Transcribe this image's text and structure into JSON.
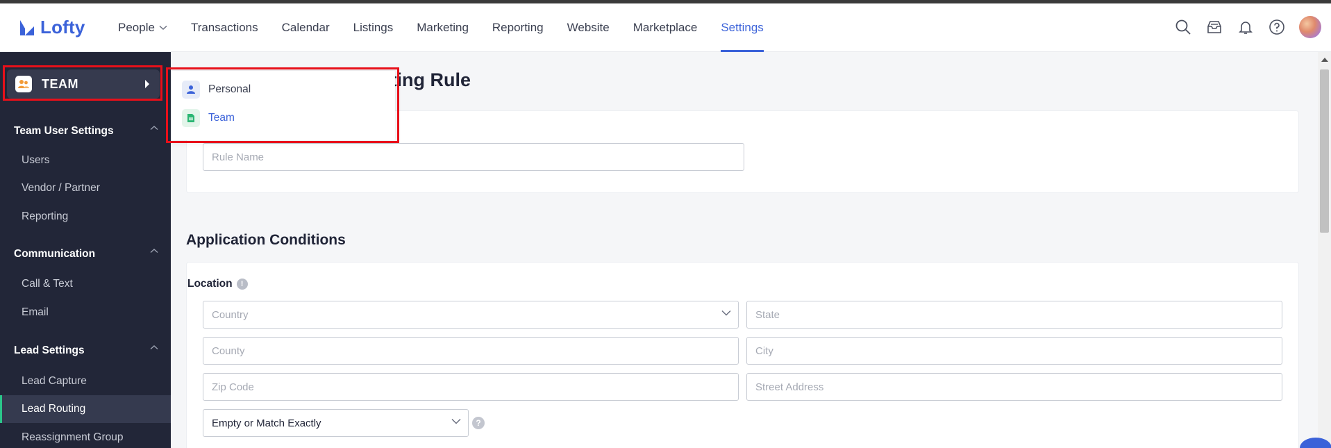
{
  "header": {
    "logo_text": "Lofty",
    "nav": [
      {
        "label": "People",
        "has_dropdown": true
      },
      {
        "label": "Transactions"
      },
      {
        "label": "Calendar"
      },
      {
        "label": "Listings"
      },
      {
        "label": "Marketing"
      },
      {
        "label": "Reporting"
      },
      {
        "label": "Website"
      },
      {
        "label": "Marketplace"
      },
      {
        "label": "Settings",
        "active": true
      }
    ],
    "icons": [
      "search-icon",
      "inbox-icon",
      "bell-icon",
      "help-icon",
      "avatar"
    ]
  },
  "sidebar": {
    "team_label": "TEAM",
    "sections": [
      {
        "title": "Team User Settings",
        "items": [
          "Users",
          "Vendor / Partner",
          "Reporting"
        ]
      },
      {
        "title": "Communication",
        "items": [
          "Call & Text",
          "Email"
        ]
      },
      {
        "title": "Lead Settings",
        "items": [
          "Lead Capture",
          "Lead Routing",
          "Reassignment Group"
        ]
      }
    ],
    "active_item": "Lead Routing"
  },
  "popup": {
    "items": [
      {
        "label": "Personal",
        "icon": "person-icon"
      },
      {
        "label": "Team",
        "icon": "team-doc-icon"
      }
    ]
  },
  "main": {
    "title": "uting Rule",
    "rule_name_placeholder": "Rule Name",
    "conditions_title": "Application Conditions",
    "location_label": "Location",
    "country_placeholder": "Country",
    "state_placeholder": "State",
    "county_placeholder": "County",
    "city_placeholder": "City",
    "zip_placeholder": "Zip Code",
    "street_placeholder": "Street Address",
    "match_value": "Empty or Match Exactly"
  },
  "colors": {
    "brand": "#3b62d9",
    "sidebar_bg": "#222638",
    "highlight": "#e8101a",
    "active_indicator": "#2bc58a"
  }
}
